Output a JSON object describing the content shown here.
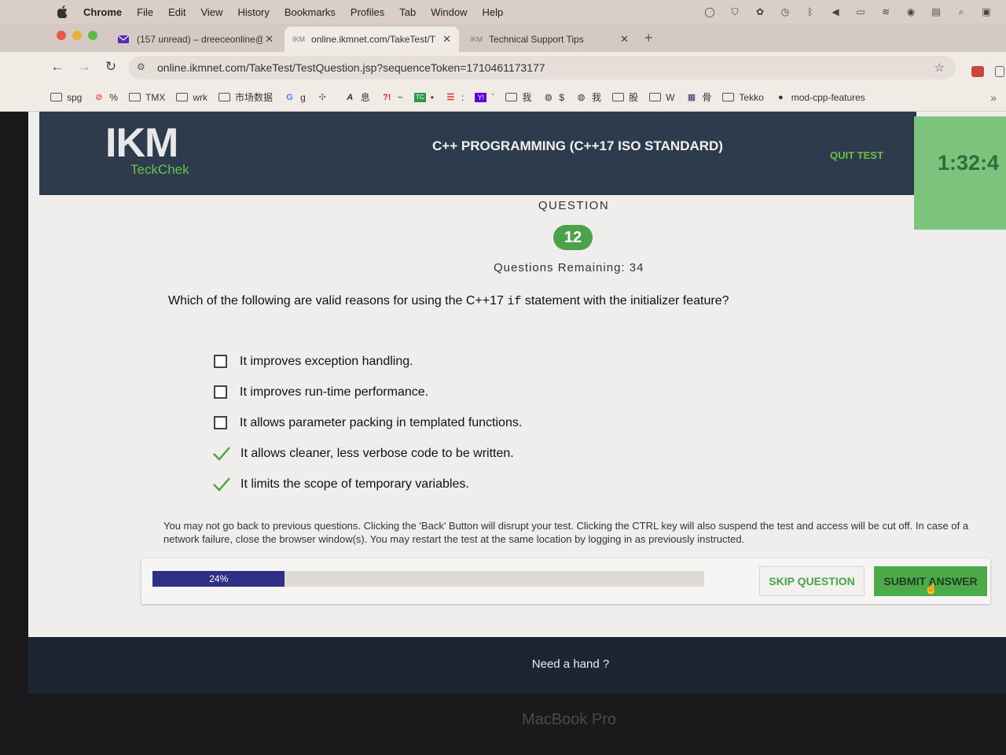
{
  "menubar": {
    "app": "Chrome",
    "items": [
      "File",
      "Edit",
      "View",
      "History",
      "Bookmarks",
      "Profiles",
      "Tab",
      "Window",
      "Help"
    ]
  },
  "tabs": [
    {
      "title": "(157 unread) – dreeceonline@",
      "icon": "mail-icon"
    },
    {
      "title": "online.ikmnet.com/TakeTest/T",
      "icon": "ikm-icon",
      "active": true
    },
    {
      "title": "Technical Support Tips",
      "icon": "ikm-icon"
    }
  ],
  "address": {
    "url": "online.ikmnet.com/TakeTest/TestQuestion.jsp?sequenceToken=1710461173177"
  },
  "bookmarks": [
    {
      "label": "spg",
      "icon": "folder"
    },
    {
      "label": "%",
      "icon": "no-icon"
    },
    {
      "label": "TMX",
      "icon": "folder"
    },
    {
      "label": "wrk",
      "icon": "folder"
    },
    {
      "label": "市场数据",
      "icon": "folder"
    },
    {
      "label": "g",
      "icon": "google-icon"
    },
    {
      "label": "",
      "icon": "plugin-icon"
    },
    {
      "label": "息",
      "icon": "a-icon"
    },
    {
      "label": "~",
      "icon": "question-icon"
    },
    {
      "label": "•",
      "icon": "tc-icon"
    },
    {
      "label": ":",
      "icon": "bars-icon"
    },
    {
      "label": "`",
      "icon": "yahoo-icon"
    },
    {
      "label": "我",
      "icon": "folder"
    },
    {
      "label": "$",
      "icon": "globe-icon"
    },
    {
      "label": "我",
      "icon": "globe-icon"
    },
    {
      "label": "股",
      "icon": "folder"
    },
    {
      "label": "W",
      "icon": "folder"
    },
    {
      "label": "骨",
      "icon": "grid-icon"
    },
    {
      "label": "Tekko",
      "icon": "folder"
    },
    {
      "label": "mod-cpp-features",
      "icon": "github-icon"
    }
  ],
  "header": {
    "logo_main": "IKM",
    "logo_sub": "TeckChek",
    "course": "C++ PROGRAMMING (C++17 ISO STANDARD)",
    "quit": "QUIT TEST",
    "timer": "1:32:4"
  },
  "question": {
    "label": "QUESTION",
    "number": "12",
    "remaining_label": "Questions Remaining:",
    "remaining": "34",
    "text_before": "Which of the following are valid reasons for using the C++17 ",
    "code": "if",
    "text_after": " statement with the initializer feature?",
    "options": [
      {
        "text": "It improves exception handling.",
        "checked": false
      },
      {
        "text": "It improves run-time performance.",
        "checked": false
      },
      {
        "text": "It allows parameter packing in templated functions.",
        "checked": false
      },
      {
        "text": "It allows cleaner, less verbose code to be written.",
        "checked": true
      },
      {
        "text": "It limits the scope of temporary variables.",
        "checked": true
      }
    ]
  },
  "notice": "You may not go back to previous questions. Clicking the 'Back' Button will disrupt your test. Clicking the CTRL key will also suspend the test and access will be cut off. In case of a network failure, close the browser window(s). You may restart the test at the same location by logging in as previously instructed.",
  "progress": {
    "percent": 24,
    "label": "24%"
  },
  "buttons": {
    "skip": "SKIP QUESTION",
    "submit": "SUBMIT ANSWER"
  },
  "help": "Need a hand ?",
  "device_label": "MacBook Pro",
  "colors": {
    "header": "#2d3b4d",
    "accent_green": "#4caa4a",
    "progress": "#2f2f86",
    "timer_bg": "#7cc47e"
  }
}
